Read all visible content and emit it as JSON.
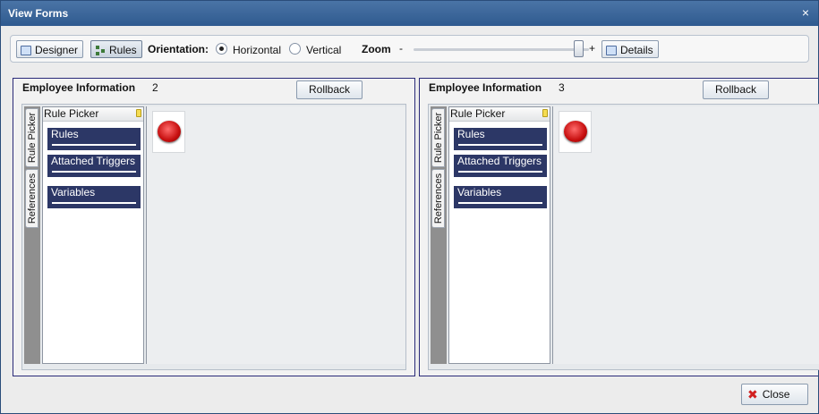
{
  "window": {
    "title": "View Forms",
    "close_glyph": "×"
  },
  "toolbar": {
    "designer_label": "Designer",
    "rules_label": "Rules",
    "orientation_label": "Orientation:",
    "horizontal_label": "Horizontal",
    "vertical_label": "Vertical",
    "zoom_label": "Zoom",
    "zoom_minus": "-",
    "zoom_plus": "+",
    "zoom_level": 0.97,
    "details_label": "Details"
  },
  "panels": [
    {
      "title": "Employee Information",
      "number": "2",
      "rollback_label": "Rollback",
      "tabs": [
        "Rule Picker",
        "References"
      ],
      "picker_title": "Rule Picker",
      "picker_items": [
        "Rules",
        "Attached Triggers",
        "Variables"
      ]
    },
    {
      "title": "Employee Information",
      "number": "3",
      "rollback_label": "Rollback",
      "tabs": [
        "Rule Picker",
        "References"
      ],
      "picker_title": "Rule Picker",
      "picker_items": [
        "Rules",
        "Attached Triggers",
        "Variables"
      ]
    }
  ],
  "footer": {
    "close_label": "Close"
  },
  "colors": {
    "title_bar": "#2f5a8f",
    "picker_item_bg": "#2c3766",
    "panel_border": "#2a2a78",
    "stop_button": "#c70f0f"
  },
  "icons": [
    "designer-icon",
    "rules-icon",
    "details-icon",
    "pin-icon",
    "stop-button-icon",
    "close-icon"
  ]
}
